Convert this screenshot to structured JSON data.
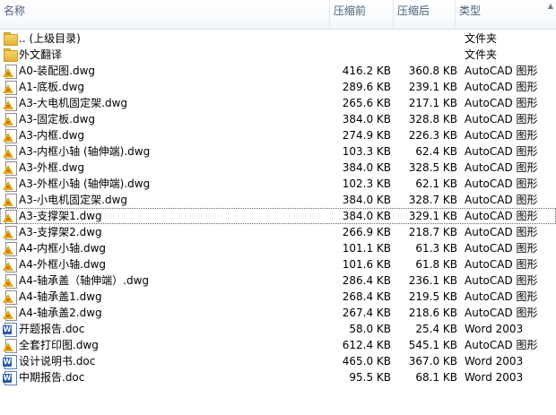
{
  "header": {
    "name": "名称",
    "packed": "压缩前",
    "size": "压缩后",
    "type": "类型"
  },
  "rows": [
    {
      "icon": "folder-icon",
      "name": ".. (上级目录)",
      "packed": "",
      "size": "",
      "type": "文件夹"
    },
    {
      "icon": "folder-icon",
      "name": "外文翻译",
      "packed": "",
      "size": "",
      "type": "文件夹"
    },
    {
      "icon": "dwg-icon",
      "name": "A0-装配图.dwg",
      "packed": "416.2 KB",
      "size": "360.8 KB",
      "type": "AutoCAD 图形"
    },
    {
      "icon": "dwg-icon",
      "name": "A1-底板.dwg",
      "packed": "289.6 KB",
      "size": "239.1 KB",
      "type": "AutoCAD 图形"
    },
    {
      "icon": "dwg-icon",
      "name": "A3-大电机固定架.dwg",
      "packed": "265.6 KB",
      "size": "217.1 KB",
      "type": "AutoCAD 图形"
    },
    {
      "icon": "dwg-icon",
      "name": "A3-固定板.dwg",
      "packed": "384.0 KB",
      "size": "328.8 KB",
      "type": "AutoCAD 图形"
    },
    {
      "icon": "dwg-icon",
      "name": "A3-内框.dwg",
      "packed": "274.9 KB",
      "size": "226.3 KB",
      "type": "AutoCAD 图形"
    },
    {
      "icon": "dwg-icon",
      "name": "A3-内框小轴 (轴伸端).dwg",
      "packed": "103.3 KB",
      "size": "62.4 KB",
      "type": "AutoCAD 图形"
    },
    {
      "icon": "dwg-icon",
      "name": "A3-外框.dwg",
      "packed": "384.0 KB",
      "size": "328.5 KB",
      "type": "AutoCAD 图形"
    },
    {
      "icon": "dwg-icon",
      "name": "A3-外框小轴 (轴伸端).dwg",
      "packed": "102.3 KB",
      "size": "62.1 KB",
      "type": "AutoCAD 图形"
    },
    {
      "icon": "dwg-icon",
      "name": "A3-小电机固定架.dwg",
      "packed": "384.0 KB",
      "size": "328.7 KB",
      "type": "AutoCAD 图形"
    },
    {
      "icon": "dwg-icon",
      "name": "A3-支撑架1.dwg",
      "packed": "384.0 KB",
      "size": "329.1 KB",
      "type": "AutoCAD 图形",
      "focused": true
    },
    {
      "icon": "dwg-icon",
      "name": "A3-支撑架2.dwg",
      "packed": "266.9 KB",
      "size": "218.7 KB",
      "type": "AutoCAD 图形"
    },
    {
      "icon": "dwg-icon",
      "name": "A4-内框小轴.dwg",
      "packed": "101.1 KB",
      "size": "61.3 KB",
      "type": "AutoCAD 图形"
    },
    {
      "icon": "dwg-icon",
      "name": "A4-外框小轴.dwg",
      "packed": "101.6 KB",
      "size": "61.8 KB",
      "type": "AutoCAD 图形"
    },
    {
      "icon": "dwg-icon",
      "name": "A4-轴承盖（轴伸端）.dwg",
      "packed": "286.4 KB",
      "size": "236.1 KB",
      "type": "AutoCAD 图形"
    },
    {
      "icon": "dwg-icon",
      "name": "A4-轴承盖1.dwg",
      "packed": "268.4 KB",
      "size": "219.5 KB",
      "type": "AutoCAD 图形"
    },
    {
      "icon": "dwg-icon",
      "name": "A4-轴承盖2.dwg",
      "packed": "267.4 KB",
      "size": "218.6 KB",
      "type": "AutoCAD 图形"
    },
    {
      "icon": "doc-icon",
      "name": "开题报告.doc",
      "packed": "58.0 KB",
      "size": "25.4 KB",
      "type": "Word 2003"
    },
    {
      "icon": "dwg-icon",
      "name": "全套打印图.dwg",
      "packed": "612.4 KB",
      "size": "545.1 KB",
      "type": "AutoCAD 图形"
    },
    {
      "icon": "doc-icon",
      "name": "设计说明书.doc",
      "packed": "465.0 KB",
      "size": "367.0 KB",
      "type": "Word 2003"
    },
    {
      "icon": "doc-icon",
      "name": "中期报告.doc",
      "packed": "95.5 KB",
      "size": "68.1 KB",
      "type": "Word 2003"
    }
  ]
}
